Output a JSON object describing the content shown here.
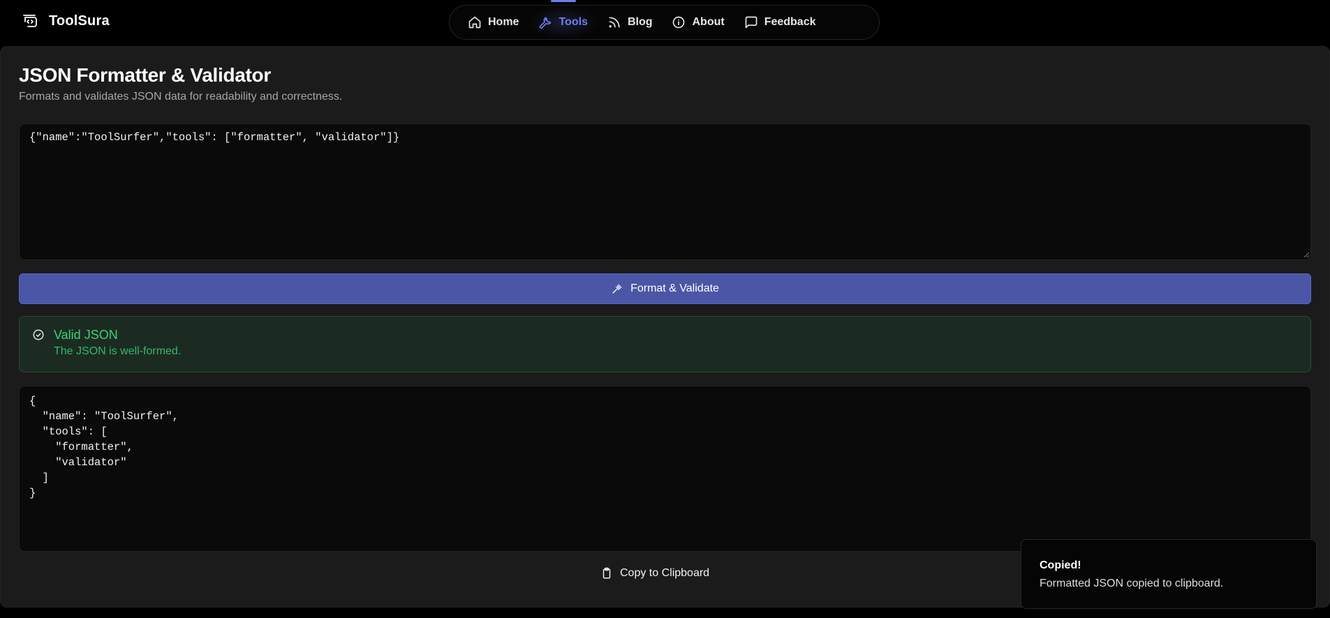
{
  "brand": {
    "name": "ToolSura",
    "logo_icon": "code-window-icon"
  },
  "nav": {
    "items": [
      {
        "label": "Home",
        "icon": "home-icon",
        "active": false
      },
      {
        "label": "Tools",
        "icon": "wrench-icon",
        "active": true
      },
      {
        "label": "Blog",
        "icon": "rss-icon",
        "active": false
      },
      {
        "label": "About",
        "icon": "info-icon",
        "active": false
      },
      {
        "label": "Feedback",
        "icon": "message-icon",
        "active": false
      }
    ],
    "accent_color": "#6f7df0"
  },
  "page": {
    "title": "JSON Formatter & Validator",
    "subtitle": "Formats and validates JSON data for readability and correctness."
  },
  "input": {
    "value": "{\"name\":\"ToolSurfer\",\"tools\": [\"formatter\", \"validator\"]}"
  },
  "format_button": {
    "label": "Format & Validate",
    "icon": "magic-wand-icon",
    "color": "#4b56a6"
  },
  "validation": {
    "title": "Valid JSON",
    "message": "The JSON is well-formed.",
    "icon": "check-circle-icon",
    "color": "#3fd17a"
  },
  "output": {
    "value": "{\n  \"name\": \"ToolSurfer\",\n  \"tools\": [\n    \"formatter\",\n    \"validator\"\n  ]\n}"
  },
  "copy_button": {
    "label": "Copy to Clipboard",
    "icon": "clipboard-icon"
  },
  "toast": {
    "title": "Copied!",
    "message": "Formatted JSON copied to clipboard."
  }
}
